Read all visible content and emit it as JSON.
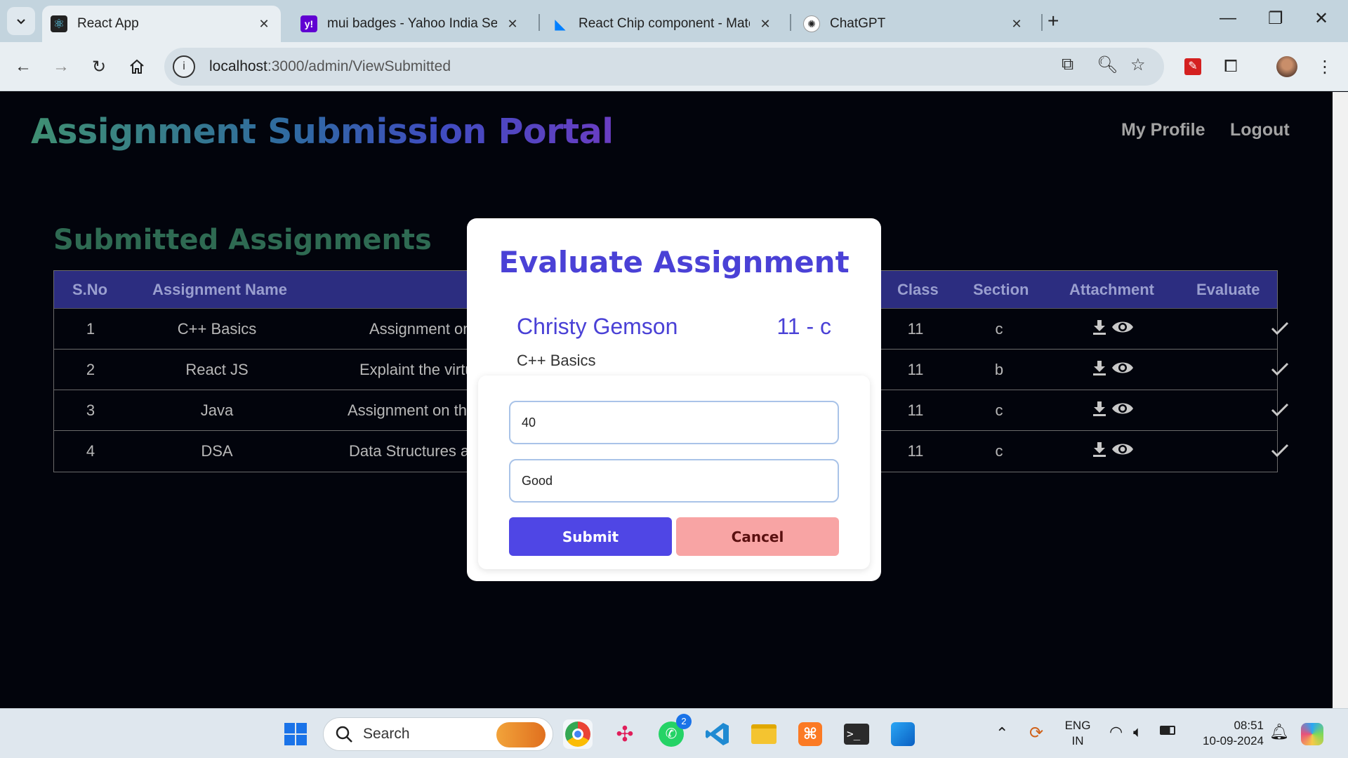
{
  "browser": {
    "tabs": [
      {
        "title": "React App",
        "active": true
      },
      {
        "title": "mui badges - Yahoo India Searc",
        "active": false
      },
      {
        "title": "React Chip component - Materi",
        "active": false
      },
      {
        "title": "ChatGPT",
        "active": false
      }
    ],
    "url_host": "localhost",
    "url_path": ":3000/admin/ViewSubmitted"
  },
  "app": {
    "logo": "Assignment Submission Portal",
    "nav": {
      "profile": "My Profile",
      "logout": "Logout"
    },
    "section_title": "Submitted Assignments"
  },
  "table": {
    "headers": {
      "sno": "S.No",
      "name": "Assignment Name",
      "class": "Class",
      "section": "Section",
      "attachment": "Attachment",
      "evaluate": "Evaluate"
    },
    "rows": [
      {
        "sno": "1",
        "name": "C++ Basics",
        "desc": "Assignment on",
        "class": "11",
        "section": "c"
      },
      {
        "sno": "2",
        "name": "React JS",
        "desc": "Explaint the virtu",
        "class": "11",
        "section": "b"
      },
      {
        "sno": "3",
        "name": "Java",
        "desc": "Assignment on the",
        "class": "11",
        "section": "c"
      },
      {
        "sno": "4",
        "name": "DSA",
        "desc": "Data Structures ar",
        "class": "11",
        "section": "c"
      }
    ]
  },
  "modal": {
    "title": "Evaluate Assignment",
    "student_name": "Christy Gemson",
    "student_class": "11 - c",
    "assignment_name": "C++ Basics",
    "marks_value": "40",
    "feedback_value": "Good",
    "submit_label": "Submit",
    "cancel_label": "Cancel"
  },
  "taskbar": {
    "search_label": "Search",
    "whatsapp_badge": "2",
    "lang_line1": "ENG",
    "lang_line2": "IN",
    "time": "08:51",
    "date": "10-09-2024"
  }
}
